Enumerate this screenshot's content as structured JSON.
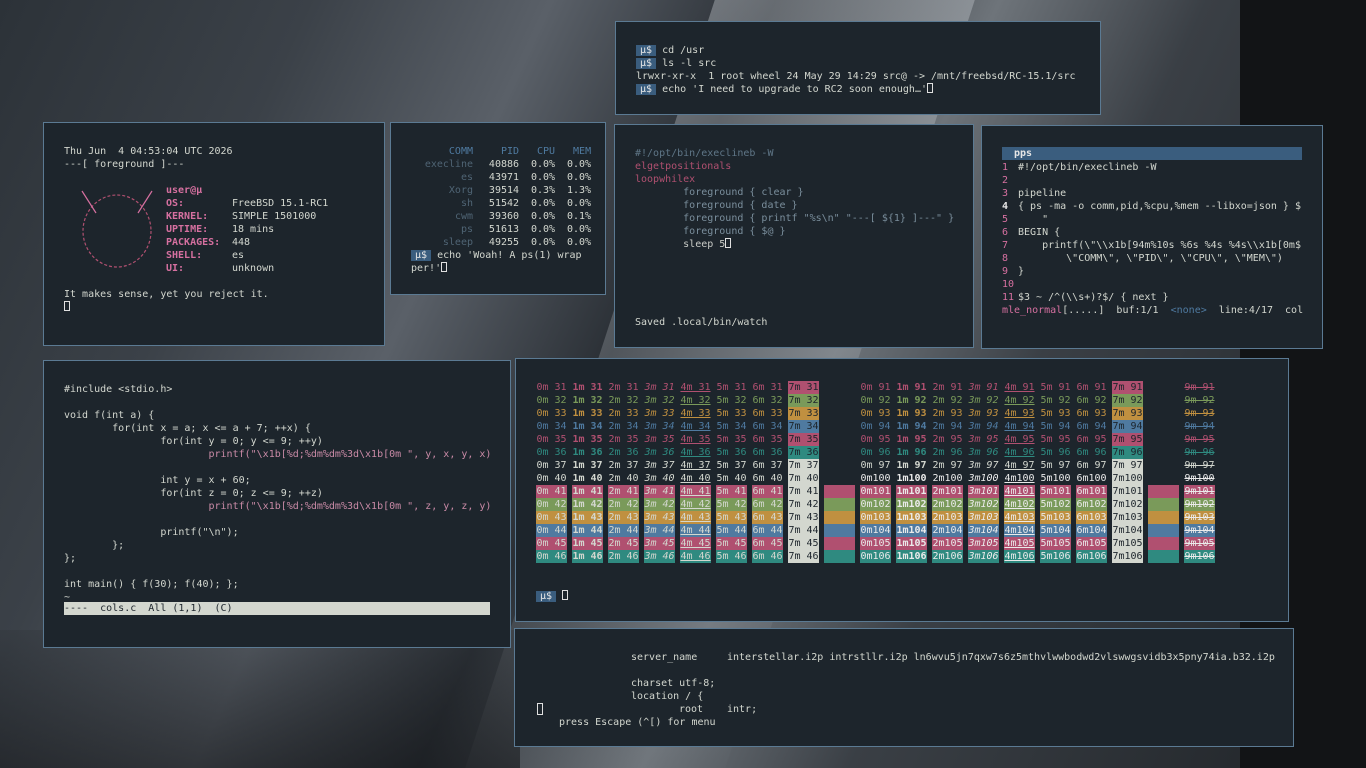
{
  "terminal_top": {
    "lines": [
      {
        "prompt": "µ$",
        "cmd": "cd /usr"
      },
      {
        "prompt": "µ$",
        "cmd": "ls -l src"
      },
      {
        "prompt": "",
        "cmd": "lrwxr-xr-x  1 root wheel 24 May 29 14:29 src@ -> /mnt/freebsd/RC-15.1/src"
      },
      {
        "prompt": "µ$",
        "cmd": "echo 'I need to upgrade to RC2 soon enough…'"
      }
    ]
  },
  "fetch": {
    "date": "Thu Jun  4 04:53:04 UTC 2026",
    "header": "---[ foreground ]---",
    "user": "user@µ",
    "os_label": "OS:",
    "os": "FreeBSD 15.1-RC1",
    "kernel_label": "KERNEL:",
    "kernel": "SIMPLE 1501000",
    "uptime_label": "UPTIME:",
    "uptime": "18 mins",
    "packages_label": "PACKAGES:",
    "packages": "448",
    "shell_label": "SHELL:",
    "shell": "es",
    "ui_label": "UI:",
    "ui": "unknown",
    "quote": "It makes sense, yet you reject it."
  },
  "ps": {
    "headers": [
      "COMM",
      "PID",
      "CPU",
      "MEM"
    ],
    "rows": [
      [
        "execline",
        "40886",
        "0.0%",
        "0.0%"
      ],
      [
        "es",
        "43971",
        "0.0%",
        "0.0%"
      ],
      [
        "Xorg",
        "39514",
        "0.3%",
        "1.3%"
      ],
      [
        "sh",
        "51542",
        "0.0%",
        "0.0%"
      ],
      [
        "cwm",
        "39360",
        "0.0%",
        "0.1%"
      ],
      [
        "ps",
        "51613",
        "0.0%",
        "0.0%"
      ],
      [
        "sleep",
        "49255",
        "0.0%",
        "0.0%"
      ]
    ],
    "prompt": "µ$",
    "cmd1": "echo 'Woah! A ps(1) wrap",
    "cmd2": "per!'"
  },
  "watch": {
    "lines": [
      "#!/opt/bin/execlineb -W",
      "elgetpositionals",
      "loopwhilex",
      "        foreground { clear }",
      "        foreground { date }",
      "        foreground { printf \"%s\\n\" \"---[ ${1} ]---\" }",
      "        foreground { $@ }",
      "        sleep 5"
    ],
    "status": "Saved .local/bin/watch"
  },
  "editor": {
    "tab": "pps",
    "lines": [
      {
        "n": "1",
        "t": "#!/opt/bin/execlineb -W"
      },
      {
        "n": "2",
        "t": ""
      },
      {
        "n": "3",
        "t": "pipeline"
      },
      {
        "n": "4",
        "t": "{ ps -ma -o comm,pid,%cpu,%mem --libxo=json } $"
      },
      {
        "n": "5",
        "t": "    \""
      },
      {
        "n": "6",
        "t": "BEGIN {"
      },
      {
        "n": "7",
        "t": "    printf(\\\"\\\\x1b[94m%10s %6s %4s %4s\\\\x1b[0m$"
      },
      {
        "n": "8",
        "t": "        \\\"COMM\\\", \\\"PID\\\", \\\"CPU\\\", \\\"MEM\\\")"
      },
      {
        "n": "9",
        "t": "}"
      },
      {
        "n": "10",
        "t": ""
      },
      {
        "n": "11",
        "t": "$3 ~ /^(\\\\s+)?$/ { next }"
      }
    ],
    "mode": "mle_normal",
    "dots": "[.....]",
    "buf": "buf:1/1",
    "none": "<none>",
    "line": "line:4/17",
    "col": "col"
  },
  "ccode": {
    "lines": [
      "#include <stdio.h>",
      "",
      "void f(int a) {",
      "        for(int x = a; x <= a + 7; ++x) {",
      "                for(int y = 0; y <= 9; ++y)",
      "                        printf(\"\\x1b[%d;%dm%dm%3d\\x1b[0m \", y, x, y, x)",
      "",
      "                int y = x + 60;",
      "                for(int z = 0; z <= 9; ++z)",
      "                        printf(\"\\x1b[%d;%dm%dm%3d\\x1b[0m \", z, y, z, y)",
      "",
      "                printf(\"\\n\");",
      "        };",
      "};",
      "",
      "int main() { f(30); f(40); };",
      "~"
    ],
    "status": "----  cols.c  All (1,1)  (C)"
  },
  "colortable": {
    "prompt": "µ$",
    "left_codes": [
      "31",
      "32",
      "33",
      "34",
      "35",
      "36",
      "37",
      "40",
      "41",
      "42",
      "43",
      "44",
      "45",
      "46"
    ],
    "right_codes": [
      "91",
      "92",
      "93",
      "94",
      "95",
      "96",
      "97",
      "100",
      "101",
      "102",
      "103",
      "104",
      "105",
      "106"
    ],
    "colors": {
      "31": "#b05070",
      "32": "#7a9a5a",
      "33": "#c09040",
      "34": "#4f7aa0",
      "35": "#b05070",
      "36": "#2f8a80",
      "37": "#d3d7cf",
      "40": "#1d252c",
      "41": "#b05070",
      "42": "#7a9a5a",
      "43": "#c09040",
      "44": "#4f7aa0",
      "45": "#b05070",
      "46": "#2f8a80"
    }
  },
  "nginx": {
    "server_name_key": "server_name",
    "server_name_val": "interstellar.i2p intrstllr.i2p ln6wvu5jn7qxw7s6z5mthvlwwbodwd2vlswwgsvidb3x5pny74ia.b32.i2p",
    "charset": "charset utf-8;",
    "location": "location / {",
    "root_key": "root",
    "root_val": "intr;",
    "hint": "press Escape (^[) for menu"
  }
}
